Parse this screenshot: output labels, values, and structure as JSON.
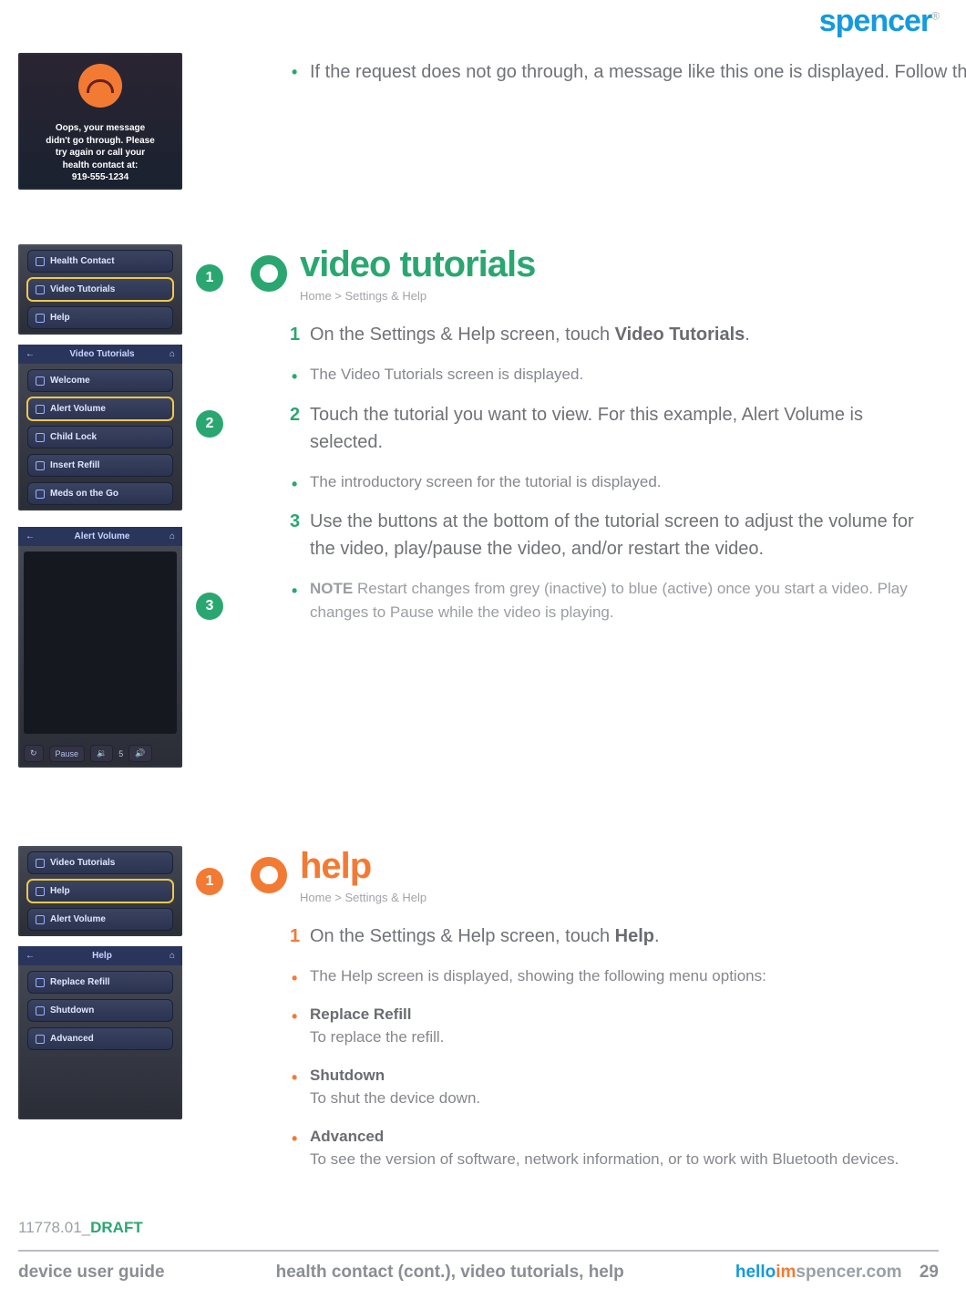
{
  "brand": "spencer",
  "intro_bullet": "If the request does not go through, a message like this one is displayed. Follow the instructions on the screen.",
  "oops": {
    "l1": "Oops, your message",
    "l2": "didn't go through. Please",
    "l3": "try again or call your",
    "l4": "health contact at:",
    "l5": "919-555-1234"
  },
  "markers": {
    "m1": "1",
    "m2": "2",
    "m3": "3",
    "h1": "1"
  },
  "shot1": {
    "a": "Health Contact",
    "b": "Video Tutorials",
    "c": "Help"
  },
  "shot2": {
    "title": "Video Tutorials",
    "items": [
      "Welcome",
      "Alert Volume",
      "Child Lock",
      "Insert Refill",
      "Meds on the Go"
    ]
  },
  "shot3": {
    "title": "Alert Volume",
    "pause": "Pause",
    "vol": "5"
  },
  "shot4": {
    "a": "Video Tutorials",
    "b": "Help",
    "c": "Alert Volume"
  },
  "shot5": {
    "title": "Help",
    "items": [
      "Replace Refill",
      "Shutdown",
      "Advanced"
    ]
  },
  "video": {
    "title": "video tutorials",
    "crumb": "Home > Settings & Help",
    "s1a": "On the Settings & Help screen, touch ",
    "s1b": "Video Tutorials",
    "s1c": ".",
    "sub1": "The Video Tutorials screen is displayed.",
    "s2": "Touch the tutorial you want to view. For this example, Alert Volume is selected.",
    "sub2": "The introductory screen for the tutorial is displayed.",
    "s3": "Use the buttons at the bottom of the tutorial screen to adjust the volume for the video, play/pause the video, and/or restart the video.",
    "noteLabel": "NOTE",
    "note": "  Restart changes from grey (inactive) to blue (active) once you start a video. Play changes to Pause while the video is playing."
  },
  "help": {
    "title": "help",
    "crumb": "Home > Settings & Help",
    "s1a": "On the Settings & Help screen, touch ",
    "s1b": "Help",
    "s1c": ".",
    "sub1": "The Help screen is displayed, showing the following menu options:",
    "opt1t": "Replace Refill",
    "opt1d": "To replace the refill.",
    "opt2t": "Shutdown",
    "opt2d": "To shut the device down.",
    "opt3t": "Advanced",
    "opt3d": "To see the version of software, network information, or to work with Bluetooth devices."
  },
  "footer": {
    "docid_a": "11778.01_",
    "docid_b": "DRAFT",
    "left": "device user guide",
    "mid": "health contact (cont.), video tutorials, help",
    "url_hello": "hello",
    "url_im": "im",
    "url_rest": "spencer.com",
    "page": "29"
  }
}
